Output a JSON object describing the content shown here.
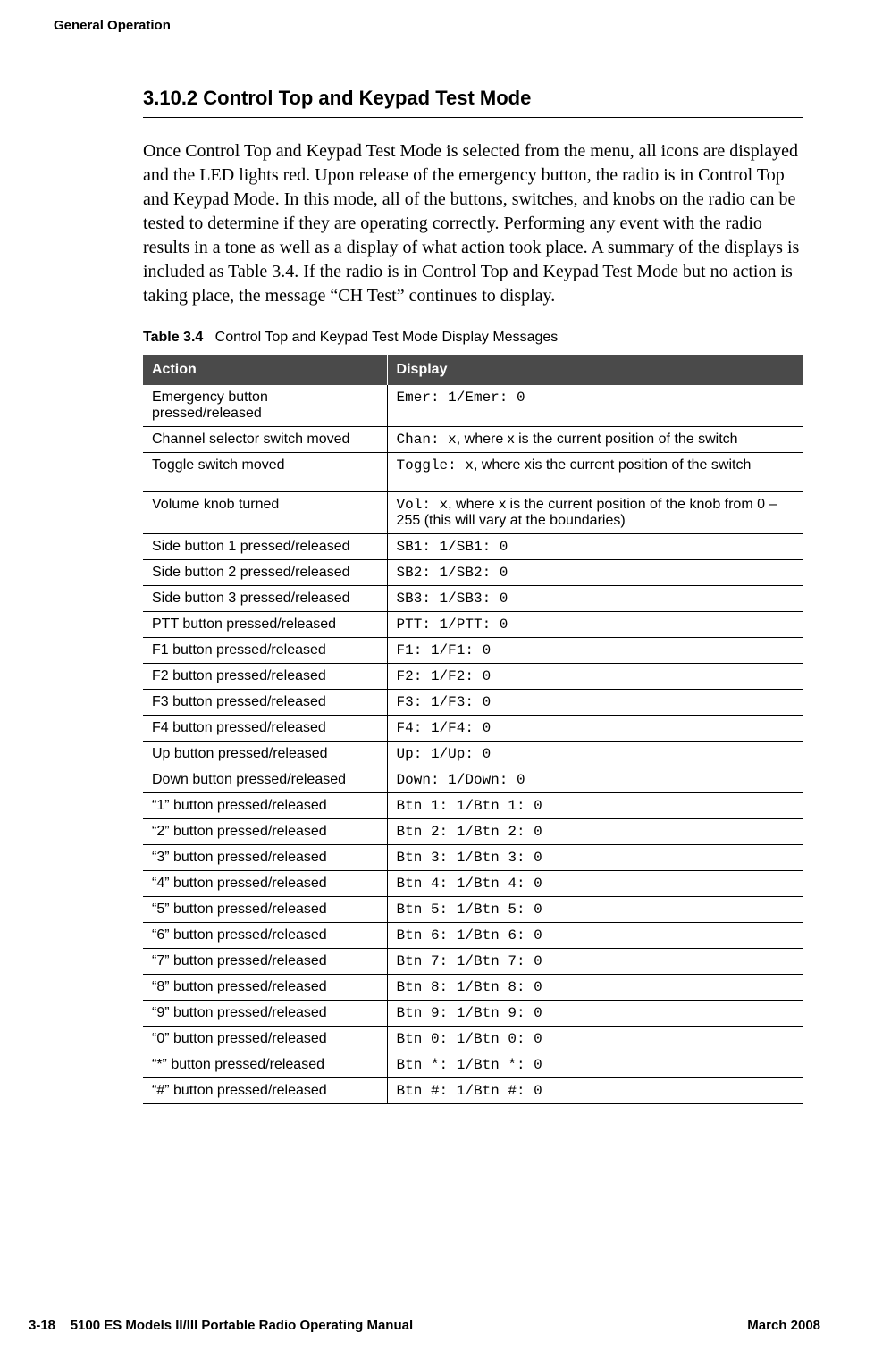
{
  "header": {
    "running_title": "General Operation"
  },
  "section": {
    "number_title": "3.10.2   Control Top and Keypad Test Mode",
    "body": "Once Control Top and Keypad Test Mode is selected from the menu, all icons are displayed and the LED lights red. Upon release of the emergency button, the radio is in Control Top and Keypad Mode. In this mode, all of the buttons, switches, and knobs on the radio can be tested to determine if they are operating correctly. Performing any event with the radio results in a tone as well as a display of what action took place. A summary of the displays is included as Table 3.4. If the radio is in Control Top and Keypad Test Mode but no action is taking place, the message “CH Test” continues to display."
  },
  "table": {
    "caption_num": "Table 3.4",
    "caption_text": "Control Top and Keypad Test Mode Display Messages",
    "head": {
      "action": "Action",
      "display": "Display"
    },
    "rows": [
      {
        "action": "Emergency button pressed/released",
        "mono": "Emer: 1/Emer: 0",
        "tail": ""
      },
      {
        "action": "Channel selector switch moved",
        "mono": "Chan: x",
        "tail": ", where x is the current position of the switch"
      },
      {
        "action": "Toggle switch moved",
        "mono": "Toggle: x",
        "tail": ", where xis the current position of the switch",
        "wide": true
      },
      {
        "action": "Volume knob turned",
        "mono": "Vol: x",
        "tail": ", where x is the current position of the knob from 0 – 255 (this will vary at the boundaries)"
      },
      {
        "action": "Side button 1 pressed/released",
        "mono": "SB1: 1/SB1: 0",
        "tail": ""
      },
      {
        "action": "Side button 2 pressed/released",
        "mono": "SB2: 1/SB2: 0",
        "tail": ""
      },
      {
        "action": "Side button 3 pressed/released",
        "mono": "SB3: 1/SB3: 0",
        "tail": ""
      },
      {
        "action": "PTT button pressed/released",
        "mono": "PTT: 1/PTT: 0",
        "tail": ""
      },
      {
        "action": "F1 button pressed/released",
        "mono": "F1: 1/F1: 0",
        "tail": ""
      },
      {
        "action": "F2 button pressed/released",
        "mono": "F2: 1/F2: 0",
        "tail": ""
      },
      {
        "action": "F3 button pressed/released",
        "mono": "F3: 1/F3: 0",
        "tail": ""
      },
      {
        "action": "F4 button pressed/released",
        "mono": "F4: 1/F4: 0",
        "tail": ""
      },
      {
        "action": "Up button pressed/released",
        "mono": "Up: 1/Up: 0",
        "tail": ""
      },
      {
        "action": "Down button pressed/released",
        "mono": "Down: 1/Down: 0",
        "tail": ""
      },
      {
        "action": "“1” button pressed/released",
        "mono": "Btn 1: 1/Btn 1: 0",
        "tail": ""
      },
      {
        "action": "“2” button pressed/released",
        "mono": "Btn 2: 1/Btn 2: 0",
        "tail": ""
      },
      {
        "action": "“3” button pressed/released",
        "mono": "Btn 3: 1/Btn 3: 0",
        "tail": ""
      },
      {
        "action": "“4” button pressed/released",
        "mono": "Btn 4: 1/Btn 4: 0",
        "tail": ""
      },
      {
        "action": "“5” button pressed/released",
        "mono": "Btn 5: 1/Btn 5: 0",
        "tail": ""
      },
      {
        "action": "“6” button pressed/released",
        "mono": "Btn 6: 1/Btn 6: 0",
        "tail": ""
      },
      {
        "action": "“7” button pressed/released",
        "mono": "Btn 7: 1/Btn 7: 0",
        "tail": ""
      },
      {
        "action": "“8” button pressed/released",
        "mono": "Btn 8: 1/Btn 8: 0",
        "tail": ""
      },
      {
        "action": "“9” button pressed/released",
        "mono": "Btn 9: 1/Btn 9: 0",
        "tail": ""
      },
      {
        "action": "“0” button pressed/released",
        "mono": "Btn 0: 1/Btn 0: 0",
        "tail": ""
      },
      {
        "action": "“*” button pressed/released",
        "mono": "Btn *: 1/Btn *: 0",
        "tail": ""
      },
      {
        "action": "“#” button pressed/released",
        "mono": "Btn #: 1/Btn #: 0",
        "tail": ""
      }
    ]
  },
  "footer": {
    "left_page": "3-18",
    "left_title": "5100 ES Models II/III Portable Radio Operating Manual",
    "right": "March 2008"
  }
}
